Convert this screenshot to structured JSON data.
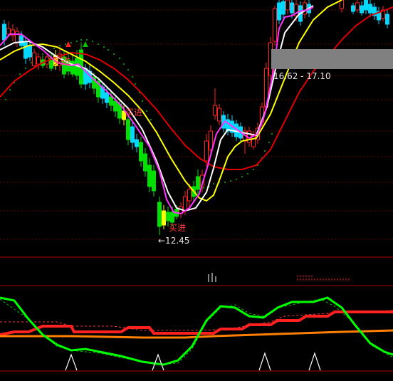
{
  "annotations": {
    "buy_label": "买进",
    "low_price_label": "←12.45",
    "range_label": "16.62 - 17.10"
  },
  "colors": {
    "background": "#000000",
    "grid": "#7a0000",
    "up_candle": "#ff2020",
    "down_candle_cyan": "#00d8ff",
    "down_candle_green": "#00e000",
    "ma_white": "#ffffff",
    "ma_yellow": "#ffff00",
    "ma_magenta": "#ff33ff",
    "ma_red": "#e00000",
    "sar_dots": "#00c000",
    "osc_green": "#00ff00",
    "osc_red": "#ff2020",
    "osc_orange": "#ff8000",
    "highlight_band": "#808080"
  }
}
